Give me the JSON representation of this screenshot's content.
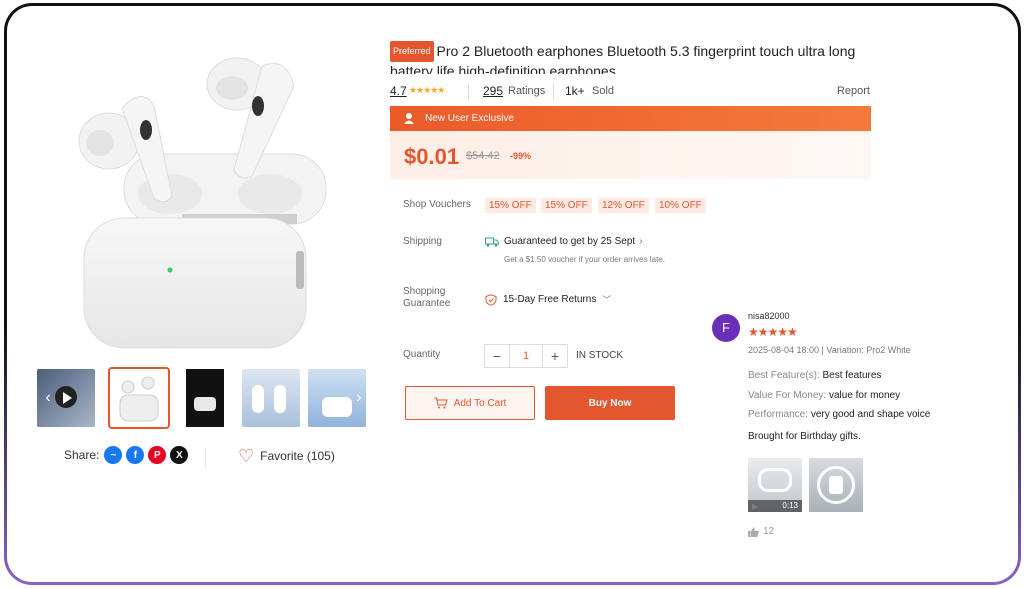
{
  "product": {
    "badge": "Preferred",
    "title": "Pro 2 Bluetooth earphones Bluetooth 5.3 fingerprint touch ultra long battery life high-definition earphones",
    "rating": "4.7",
    "ratings_count": "295",
    "ratings_label": "Ratings",
    "sold_count": "1k+",
    "sold_label": "Sold",
    "report_label": "Report"
  },
  "promo": {
    "label": "New User Exclusive",
    "price": "$0.01",
    "original_price": "$54.42",
    "discount": "-99%"
  },
  "vouchers": {
    "label": "Shop Vouchers",
    "items": [
      "15% OFF",
      "15% OFF",
      "12% OFF",
      "10% OFF"
    ]
  },
  "shipping": {
    "label": "Shipping",
    "main": "Guaranteed to get by 25 Sept",
    "sub": "Get a $1.50 voucher if your order arrives late."
  },
  "guarantee": {
    "label_line1": "Shopping",
    "label_line2": "Guarantee",
    "value": "15-Day Free Returns"
  },
  "quantity": {
    "label": "Quantity",
    "value": "1",
    "minus": "−",
    "plus": "+",
    "stock": "IN STOCK"
  },
  "actions": {
    "add_to_cart": "Add To Cart",
    "buy_now": "Buy Now"
  },
  "share": {
    "label": "Share:",
    "favorite": "Favorite (105)"
  },
  "review": {
    "avatar_letter": "F",
    "user": "nisa82000",
    "meta": "2025-08-04 18:00 | Variation: Pro2 White",
    "features_label": "Best Feature(s):",
    "features_value": "Best features",
    "value_label": "Value For Money:",
    "value_value": "value  for money",
    "performance_label": "Performance:",
    "performance_value": "very good and shape  voice",
    "text": "Brought  for Birthday gifts.",
    "video_duration": "0:13",
    "likes": "12"
  },
  "icons": [
    "play-icon",
    "chevron-left-icon",
    "chevron-right-icon",
    "messenger-icon",
    "facebook-icon",
    "pinterest-icon",
    "x-icon",
    "heart-icon",
    "user-badge-icon",
    "truck-icon",
    "shield-icon",
    "cart-icon",
    "thumbs-up-icon",
    "video-icon"
  ],
  "colors": {
    "accent": "#e4572e",
    "avatar": "#6a2fb8",
    "star": "#f5a623"
  }
}
